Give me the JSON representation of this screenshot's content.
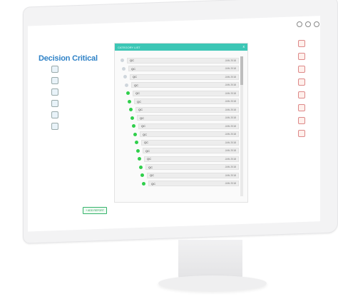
{
  "app": {
    "brand": "Decision Critical"
  },
  "panel": {
    "tab_label": "CATEGORY LIST",
    "close_label": "x"
  },
  "rows": [
    {
      "label": "QC",
      "date": "JAN 2018"
    },
    {
      "label": "QC",
      "date": "JAN 2018"
    },
    {
      "label": "QC",
      "date": "JAN 2018"
    },
    {
      "label": "QC",
      "date": "JAN 2018"
    },
    {
      "label": "QC",
      "date": "JAN 2018"
    },
    {
      "label": "QC",
      "date": "JAN 2018"
    },
    {
      "label": "QC",
      "date": "JAN 2018"
    },
    {
      "label": "QC",
      "date": "JAN 2018"
    },
    {
      "label": "QC",
      "date": "JAN 2018"
    },
    {
      "label": "QC",
      "date": "JAN 2018"
    },
    {
      "label": "QC",
      "date": "JAN 2018"
    },
    {
      "label": "QC",
      "date": "JAN 2018"
    },
    {
      "label": "QC",
      "date": "JAN 2018"
    },
    {
      "label": "QC",
      "date": "JAN 2018"
    },
    {
      "label": "QC",
      "date": "JAN 2018"
    },
    {
      "label": "QC",
      "date": "JAN 2018"
    }
  ],
  "actions": {
    "add_label": "+ ADD REPORT"
  },
  "colors": {
    "accent": "#3cc6b5",
    "status_green": "#2fcf4b",
    "brand_blue": "#2f82c7"
  }
}
